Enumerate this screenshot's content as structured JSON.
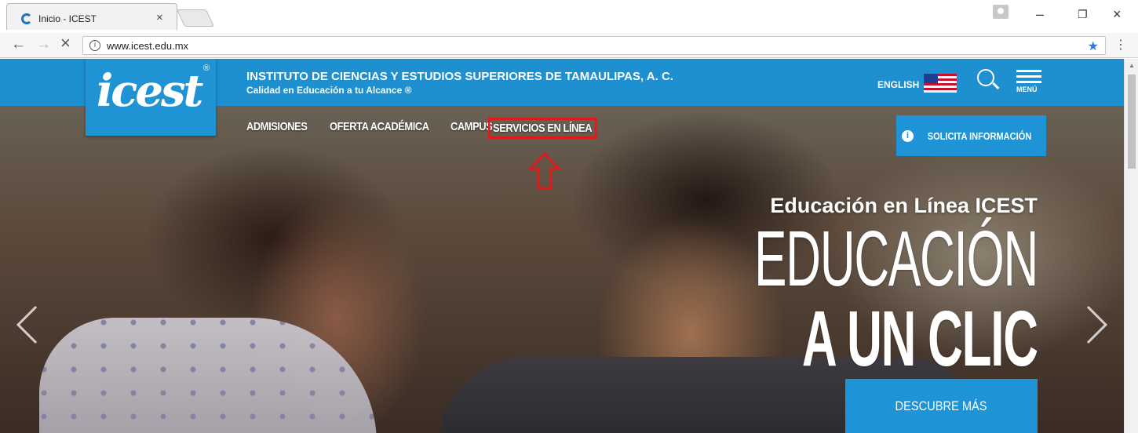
{
  "browser": {
    "tab_title": "Inicio - ICEST",
    "tab_close": "×",
    "url": "www.icest.edu.mx",
    "info_glyph": "i",
    "back": "←",
    "forward": "→",
    "stop": "×",
    "star": "★",
    "menu": "⋮",
    "minimize": "–",
    "restore": "❐",
    "close": "×"
  },
  "site": {
    "logo_text": "icest",
    "logo_reg": "®",
    "institute_name": "INSTITUTO DE CIENCIAS Y ESTUDIOS SUPERIORES DE TAMAULIPAS, A. C.",
    "tagline": "Calidad en Educación a tu Alcance ®",
    "english_label": "ENGLISH",
    "menu_label": "MENÚ",
    "nav": [
      {
        "label": "ADMISIONES"
      },
      {
        "label": "OFERTA ACADÉMICA"
      },
      {
        "label": "CAMPUS"
      },
      {
        "label": "SERVICIOS EN LÍNEA"
      }
    ],
    "solicita_label": "SOLICITA INFORMACIÓN",
    "info_badge": "i"
  },
  "hero": {
    "kicker": "Educación en Línea ICEST",
    "line1": "EDUCACIÓN",
    "line2": "A UN CLIC",
    "cta_label": "DESCUBRE MÁS"
  },
  "colors": {
    "brand_blue": "#1e8fcf",
    "highlight_red": "#e01a1a"
  }
}
